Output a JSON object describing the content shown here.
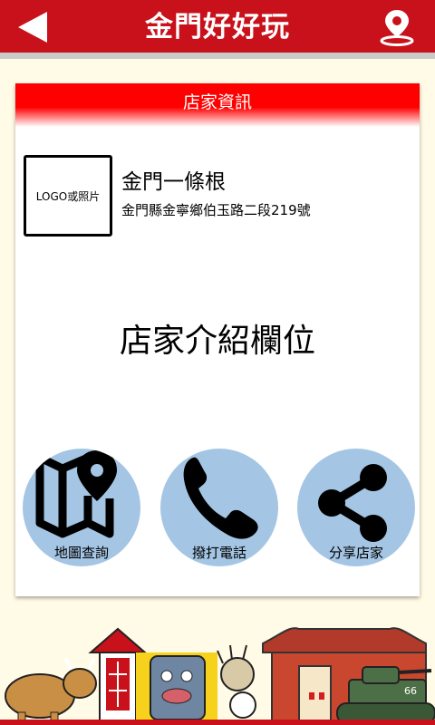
{
  "app": {
    "title": "金門好好玩"
  },
  "card": {
    "header": "店家資訊",
    "logo_placeholder": "LOGO或照片",
    "shop_name": "金門一條根",
    "shop_address": "金門縣金寧鄉伯玉路二段219號",
    "intro_placeholder": "店家介紹欄位"
  },
  "actions": [
    {
      "label": "地圖查詢",
      "icon": "map-pin-icon"
    },
    {
      "label": "撥打電話",
      "icon": "phone-icon"
    },
    {
      "label": "分享店家",
      "icon": "share-icon"
    }
  ],
  "footer": {
    "tank_number": "66"
  },
  "colors": {
    "topbar": "#c8111a",
    "header_red": "#ff0000",
    "action_circle": "#a4c6e4",
    "background": "#fffbe6"
  }
}
